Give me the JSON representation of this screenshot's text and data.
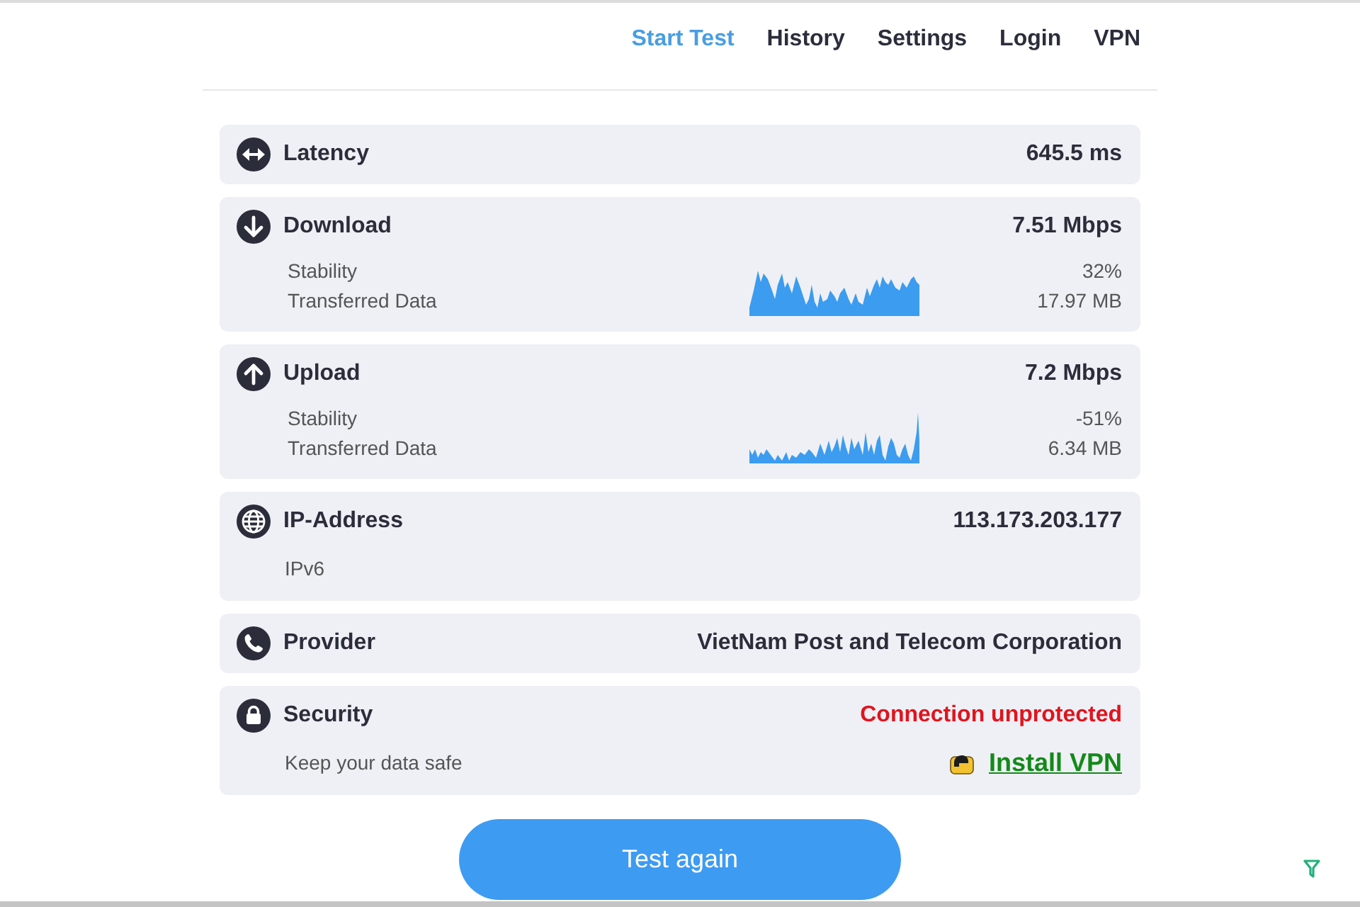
{
  "nav": [
    {
      "label": "Start Test",
      "selected": true
    },
    {
      "label": "History",
      "selected": false
    },
    {
      "label": "Settings",
      "selected": false
    },
    {
      "label": "Login",
      "selected": false
    },
    {
      "label": "VPN",
      "selected": false
    }
  ],
  "cards": [
    {
      "kind": "latency",
      "title": "Latency",
      "value": "645.5 ms"
    },
    {
      "kind": "download",
      "title": "Download",
      "value": "7.51 Mbps",
      "stats": [
        {
          "label": "Stability",
          "value": "32%"
        },
        {
          "label": "Transferred Data",
          "value": "17.97 MB"
        }
      ]
    },
    {
      "kind": "upload",
      "title": "Upload",
      "value": "7.2 Mbps",
      "stats": [
        {
          "label": "Stability",
          "value": "-51%"
        },
        {
          "label": "Transferred Data",
          "value": "6.34 MB"
        }
      ]
    },
    {
      "kind": "ip",
      "title": "IP-Address",
      "value": "113.173.203.177",
      "subtitle": "IPv6"
    },
    {
      "kind": "provider",
      "title": "Provider",
      "value": "VietNam Post and Telecom Corporation"
    },
    {
      "kind": "security",
      "title": "Security",
      "value": "Connection unprotected",
      "subtitle": "Keep your data safe",
      "link": "Install VPN"
    }
  ],
  "button": "Test again"
}
